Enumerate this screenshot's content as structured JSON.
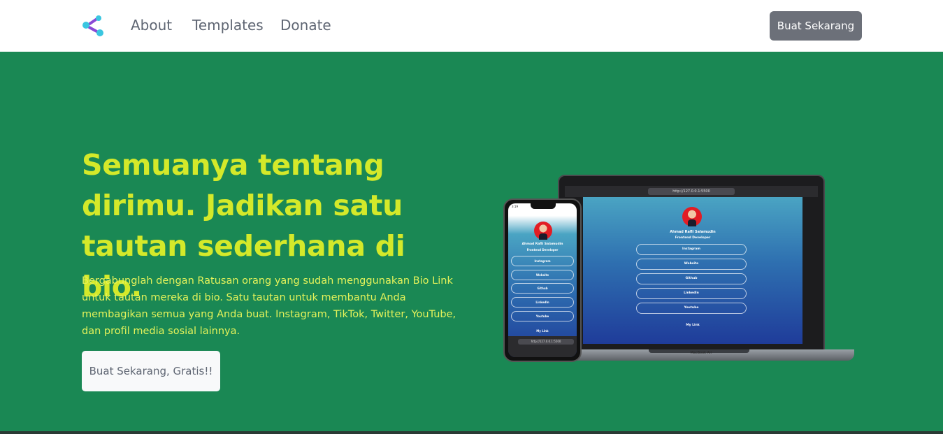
{
  "nav": {
    "links": [
      {
        "label": "About"
      },
      {
        "label": "Templates"
      },
      {
        "label": "Donate"
      }
    ],
    "cta_label": "Buat Sekarang"
  },
  "hero": {
    "title": "Semuanya tentang dirimu. Jadikan satu tautan sederhana di bio.",
    "description": "Bergabunglah dengan Ratusan orang yang sudah menggunakan Bio Link untuk tautan mereka di bio. Satu tautan untuk membantu Anda membagikan semua yang Anda buat. Instagram, TikTok, Twitter, YouTube, dan profil media sosial lainnya.",
    "cta_label": "Buat Sekarang, Gratis!!"
  },
  "preview": {
    "name": "Ahmad Rafli Salamudin",
    "role": "Frontend Developer",
    "links": [
      "Instagram",
      "Website",
      "Github",
      "LinkedIn",
      "Youtube"
    ],
    "footer": "My Link",
    "url": "http://127.0.0.1:5500",
    "laptop_label": "MacBook Air",
    "phone_time": "3:19"
  },
  "colors": {
    "hero_bg": "#1a8854",
    "title": "#d4e92a",
    "nav_cta_bg": "#6c7079"
  },
  "icons": {
    "logo": "share-nodes-icon"
  }
}
